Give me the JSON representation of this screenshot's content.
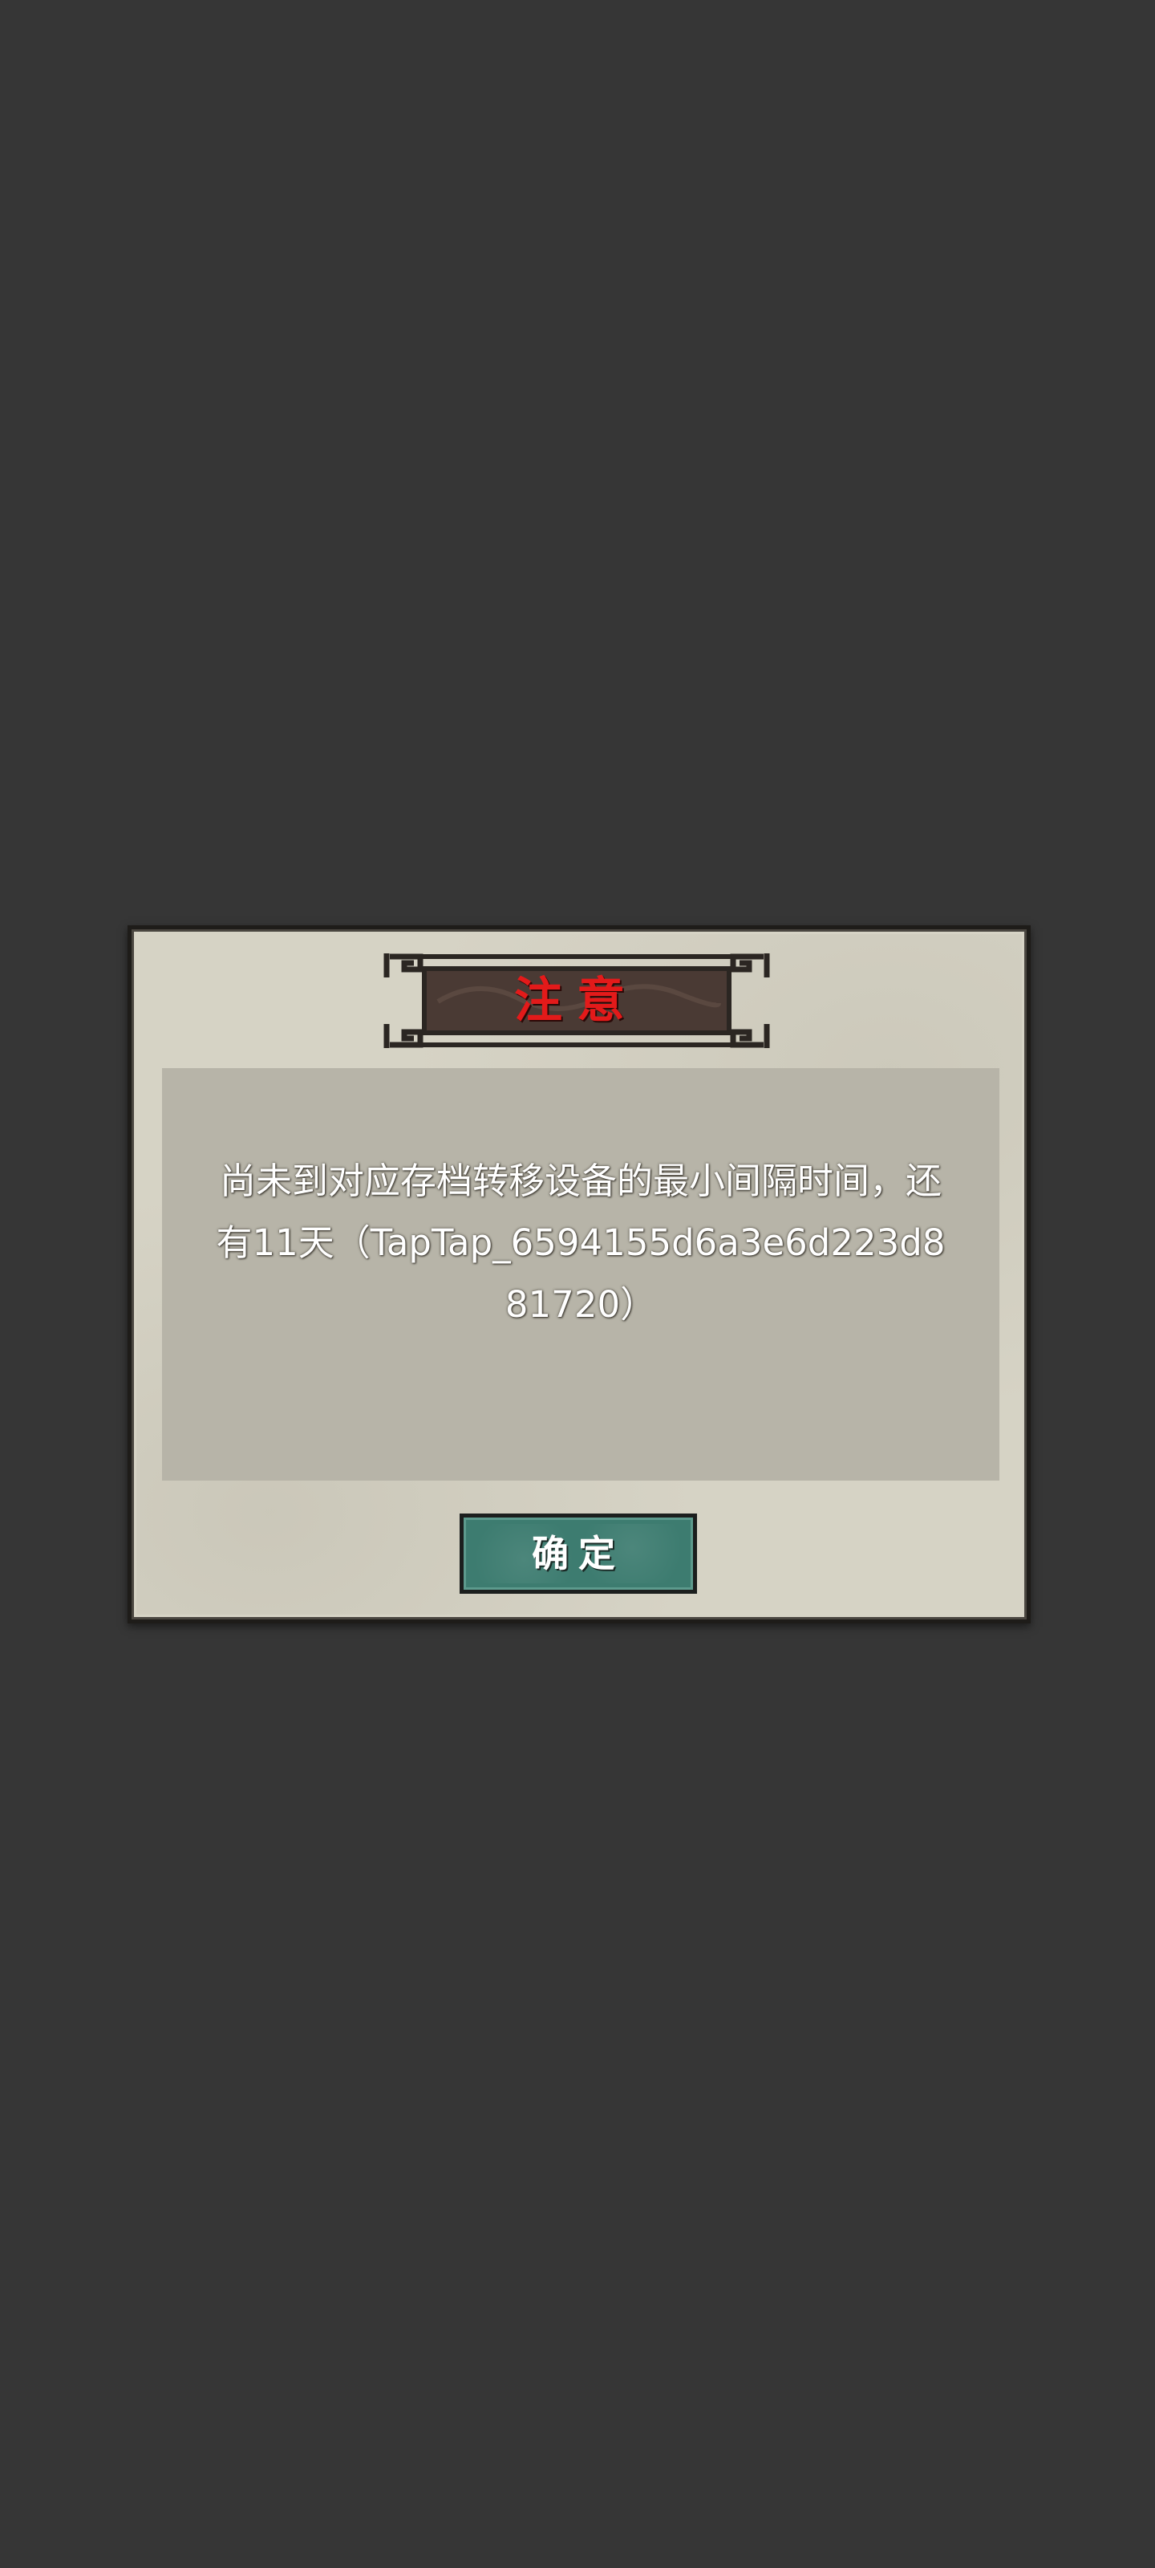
{
  "dialog": {
    "title": "注意",
    "message": "尚未到对应存档转移设备的最小间隔时间，还有11天（TapTap_6594155d6a3e6d223d881720）",
    "confirm_label": "确定"
  },
  "colors": {
    "backdrop": "#363636",
    "dialog_background": "#d6d3c5",
    "message_panel": "#b7b4a8",
    "title_plaque": "#4a3a34",
    "title_text": "#e31a1a",
    "confirm_button": "#3d7c70",
    "text": "#ffffff"
  }
}
